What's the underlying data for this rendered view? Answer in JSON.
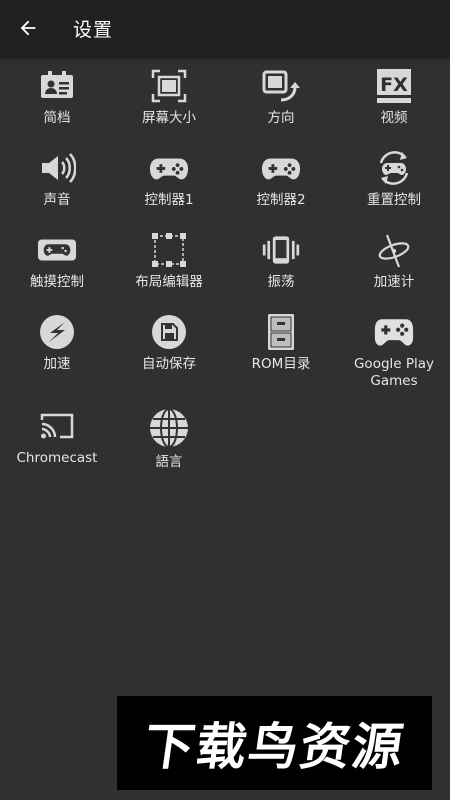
{
  "appbar": {
    "title": "设置"
  },
  "tiles": [
    {
      "label": "简档",
      "icon": "profile-card-icon"
    },
    {
      "label": "屏幕大小",
      "icon": "screen-size-icon"
    },
    {
      "label": "方向",
      "icon": "rotate-icon"
    },
    {
      "label": "视频",
      "icon": "fx-video-icon"
    },
    {
      "label": "声音",
      "icon": "speaker-icon"
    },
    {
      "label": "控制器1",
      "icon": "gamepad-icon"
    },
    {
      "label": "控制器2",
      "icon": "gamepad-icon"
    },
    {
      "label": "重置控制",
      "icon": "reset-gamepad-icon"
    },
    {
      "label": "触摸控制",
      "icon": "touch-gamepad-icon"
    },
    {
      "label": "布局编辑器",
      "icon": "layout-editor-icon"
    },
    {
      "label": "振荡",
      "icon": "vibrate-icon"
    },
    {
      "label": "加速计",
      "icon": "accelerometer-icon"
    },
    {
      "label": "加速",
      "icon": "speed-bolt-icon"
    },
    {
      "label": "自动保存",
      "icon": "save-icon"
    },
    {
      "label": "ROM目录",
      "icon": "cabinet-icon"
    },
    {
      "label": "Google Play\nGames",
      "icon": "controller-icon"
    },
    {
      "label": "Chromecast",
      "icon": "cast-icon"
    },
    {
      "label": "語言",
      "icon": "globe-icon"
    }
  ],
  "watermark": {
    "text": "下载鸟资源"
  }
}
